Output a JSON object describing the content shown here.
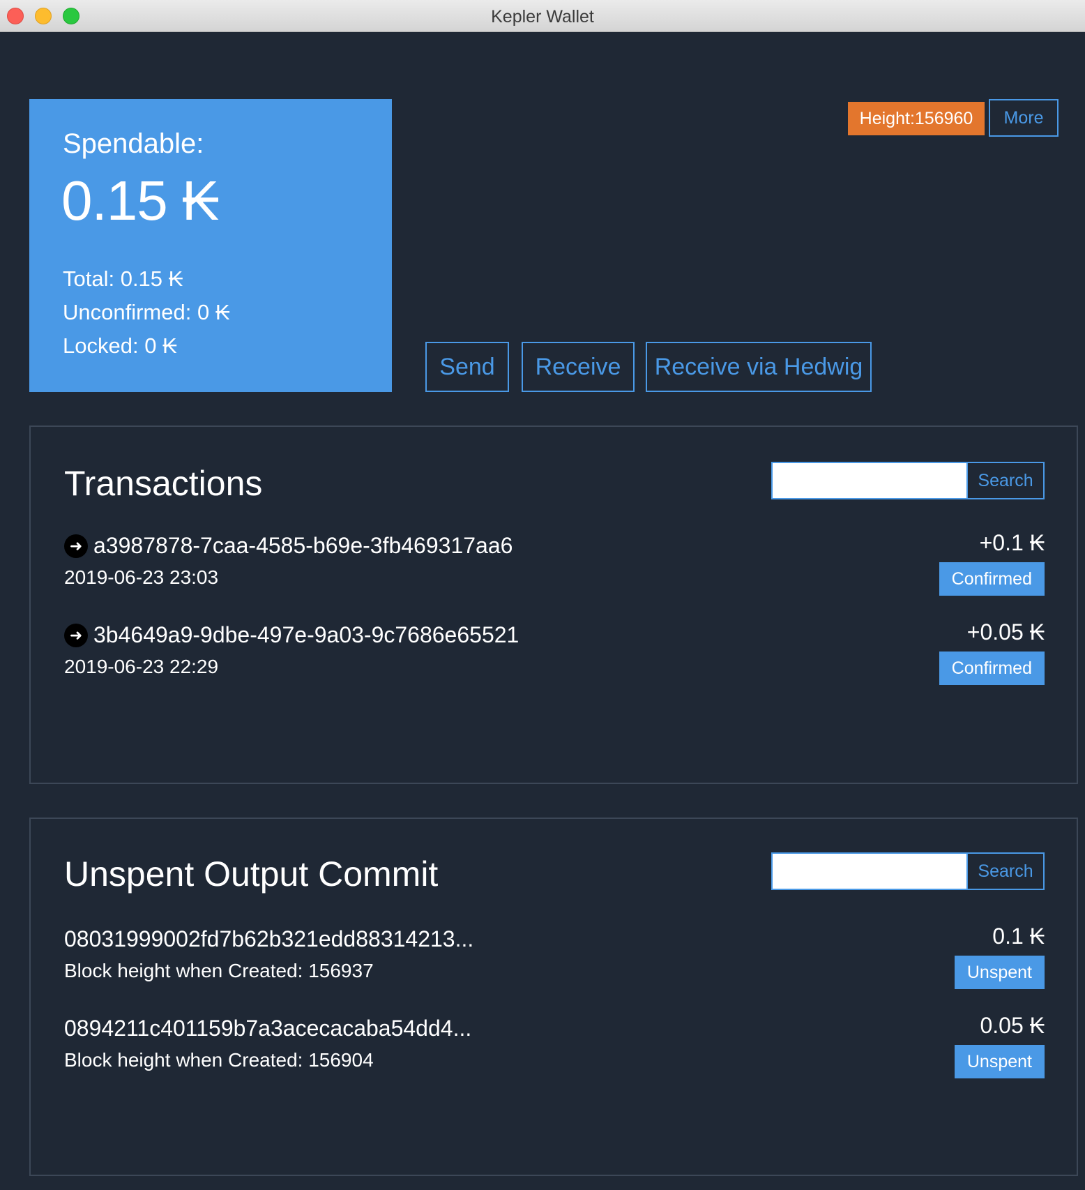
{
  "window": {
    "title": "Kepler Wallet"
  },
  "balance": {
    "spendable_label": "Spendable:",
    "spendable_amount": "0.15 ₭",
    "total": "Total: 0.15 ₭",
    "unconfirmed": "Unconfirmed: 0 ₭",
    "locked": "Locked: 0 ₭"
  },
  "header": {
    "height_badge": "Height:156960",
    "more_label": "More"
  },
  "actions": {
    "send_label": "Send",
    "receive_label": "Receive",
    "receive_hedwig_label": "Receive via Hedwig"
  },
  "transactions": {
    "title": "Transactions",
    "search_value": "",
    "search_placeholder": "",
    "search_label": "Search",
    "items": [
      {
        "id": "a3987878-7caa-4585-b69e-3fb469317aa6",
        "date": "2019-06-23 23:03",
        "amount": "+0.1 ₭",
        "status": "Confirmed",
        "icon": "arrow-right-circle-icon"
      },
      {
        "id": "3b4649a9-9dbe-497e-9a03-9c7686e65521",
        "date": "2019-06-23 22:29",
        "amount": "+0.05 ₭",
        "status": "Confirmed",
        "icon": "arrow-right-circle-icon"
      }
    ]
  },
  "outputs": {
    "title": "Unspent Output Commit",
    "search_value": "",
    "search_placeholder": "",
    "search_label": "Search",
    "items": [
      {
        "commit": "08031999002fd7b62b321edd88314213...",
        "block_height": "Block height when Created: 156937",
        "amount": "0.1 ₭",
        "status": "Unspent"
      },
      {
        "commit": "0894211c401159b7a3acecacaba54dd4...",
        "block_height": "Block height when Created: 156904",
        "amount": "0.05 ₭",
        "status": "Unspent"
      }
    ]
  },
  "colors": {
    "background": "#1f2835",
    "accent": "#4a99e6",
    "height_badge": "#e3762d",
    "panel_border": "#3c4757"
  }
}
